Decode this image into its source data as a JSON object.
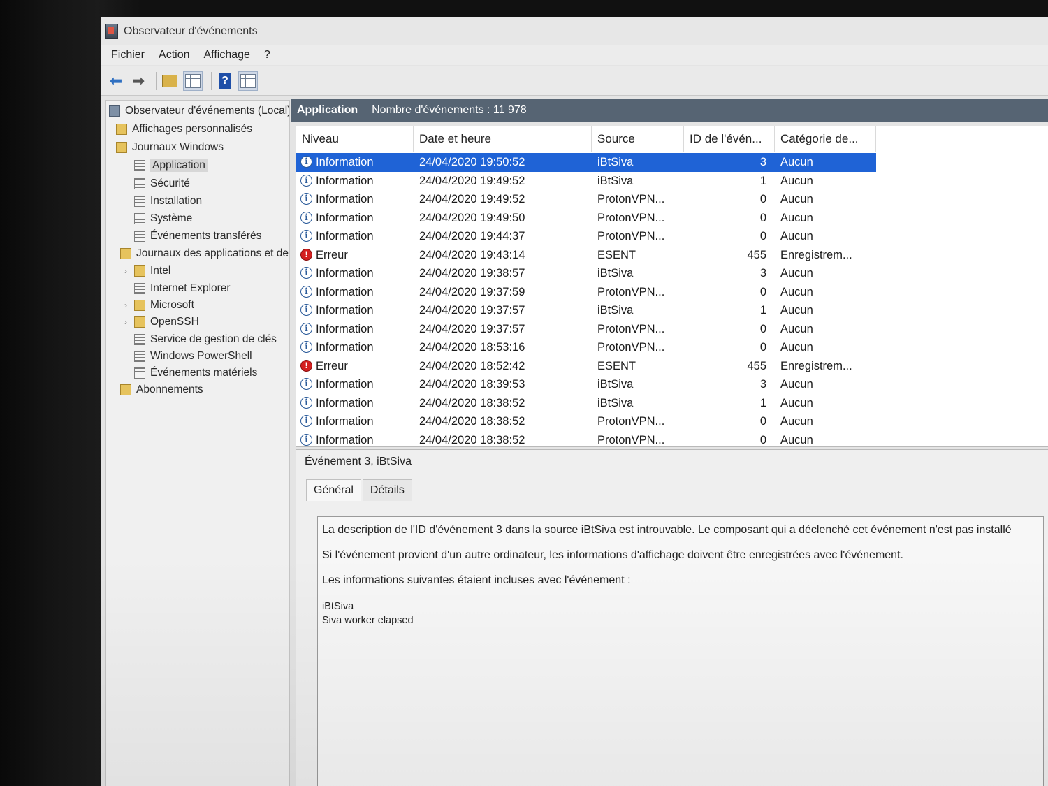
{
  "window": {
    "title": "Observateur d'événements"
  },
  "menu": [
    "Fichier",
    "Action",
    "Affichage",
    "?"
  ],
  "toolbar": {
    "icons": [
      "back-arrow-icon",
      "forward-arrow-icon",
      "folder-up-icon",
      "show-hide-tree-icon",
      "help-icon",
      "show-hide-action-pane-icon"
    ]
  },
  "tree": {
    "root": "Observateur d'événements (Local)",
    "custom_views": "Affichages personnalisés",
    "windows_logs": "Journaux Windows",
    "windows_logs_items": [
      "Application",
      "Sécurité",
      "Installation",
      "Système",
      "Événements transférés"
    ],
    "apps_logs": "Journaux des applications et de",
    "apps_logs_items": [
      "Intel",
      "Internet Explorer",
      "Microsoft",
      "OpenSSH",
      "Service de gestion de clés",
      "Windows PowerShell",
      "Événements matériels"
    ],
    "subscriptions": "Abonnements"
  },
  "header": {
    "log_name": "Application",
    "count_label": "Nombre d'événements : 11 978"
  },
  "table": {
    "columns": [
      "Niveau",
      "Date et heure",
      "Source",
      "ID de l'évén...",
      "Catégorie de..."
    ],
    "rows": [
      {
        "level": "Information",
        "type": "info",
        "date": "24/04/2020 19:50:52",
        "source": "iBtSiva",
        "id": "3",
        "category": "Aucun"
      },
      {
        "level": "Information",
        "type": "info",
        "date": "24/04/2020 19:49:52",
        "source": "iBtSiva",
        "id": "1",
        "category": "Aucun"
      },
      {
        "level": "Information",
        "type": "info",
        "date": "24/04/2020 19:49:52",
        "source": "ProtonVPN...",
        "id": "0",
        "category": "Aucun"
      },
      {
        "level": "Information",
        "type": "info",
        "date": "24/04/2020 19:49:50",
        "source": "ProtonVPN...",
        "id": "0",
        "category": "Aucun"
      },
      {
        "level": "Information",
        "type": "info",
        "date": "24/04/2020 19:44:37",
        "source": "ProtonVPN...",
        "id": "0",
        "category": "Aucun"
      },
      {
        "level": "Erreur",
        "type": "err",
        "date": "24/04/2020 19:43:14",
        "source": "ESENT",
        "id": "455",
        "category": "Enregistrem..."
      },
      {
        "level": "Information",
        "type": "info",
        "date": "24/04/2020 19:38:57",
        "source": "iBtSiva",
        "id": "3",
        "category": "Aucun"
      },
      {
        "level": "Information",
        "type": "info",
        "date": "24/04/2020 19:37:59",
        "source": "ProtonVPN...",
        "id": "0",
        "category": "Aucun"
      },
      {
        "level": "Information",
        "type": "info",
        "date": "24/04/2020 19:37:57",
        "source": "iBtSiva",
        "id": "1",
        "category": "Aucun"
      },
      {
        "level": "Information",
        "type": "info",
        "date": "24/04/2020 19:37:57",
        "source": "ProtonVPN...",
        "id": "0",
        "category": "Aucun"
      },
      {
        "level": "Information",
        "type": "info",
        "date": "24/04/2020 18:53:16",
        "source": "ProtonVPN...",
        "id": "0",
        "category": "Aucun"
      },
      {
        "level": "Erreur",
        "type": "err",
        "date": "24/04/2020 18:52:42",
        "source": "ESENT",
        "id": "455",
        "category": "Enregistrem..."
      },
      {
        "level": "Information",
        "type": "info",
        "date": "24/04/2020 18:39:53",
        "source": "iBtSiva",
        "id": "3",
        "category": "Aucun"
      },
      {
        "level": "Information",
        "type": "info",
        "date": "24/04/2020 18:38:52",
        "source": "iBtSiva",
        "id": "1",
        "category": "Aucun"
      },
      {
        "level": "Information",
        "type": "info",
        "date": "24/04/2020 18:38:52",
        "source": "ProtonVPN...",
        "id": "0",
        "category": "Aucun"
      },
      {
        "level": "Information",
        "type": "info",
        "date": "24/04/2020 18:38:52",
        "source": "ProtonVPN...",
        "id": "0",
        "category": "Aucun"
      }
    ]
  },
  "detail": {
    "title": "Événement 3, iBtSiva",
    "tabs": [
      "Général",
      "Détails"
    ],
    "lines": [
      "La description de l'ID d'événement 3 dans la source iBtSiva est introuvable. Le composant qui a déclenché cet événement n'est pas installé",
      "Si l'événement provient d'un autre ordinateur, les informations d'affichage doivent être enregistrées avec l'événement.",
      "Les informations suivantes étaient incluses avec l'événement :"
    ],
    "extra": [
      "iBtSiva",
      "Siva worker elapsed"
    ]
  },
  "colors": {
    "selection": "#1f63d6",
    "header_bar": "#566473",
    "error": "#d42020",
    "info": "#2b5b9a"
  }
}
